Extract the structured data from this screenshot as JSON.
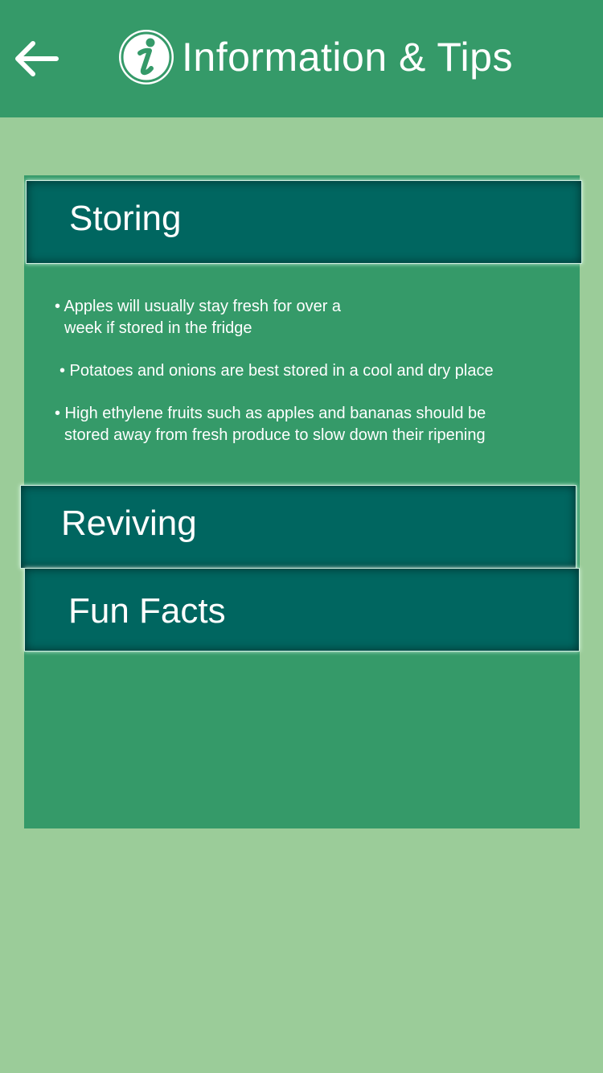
{
  "header": {
    "title": "Information & Tips",
    "back_icon": "arrow-left-icon",
    "info_icon": "info-icon",
    "background_color": "#359a69"
  },
  "sections": [
    {
      "label": "Storing",
      "expanded": true,
      "tips": [
        {
          "lines": [
            "• Apples will usually stay fresh for over a",
            "week if stored in the fridge"
          ]
        },
        {
          "lines": [
            "• Potatoes and onions are best stored in a cool and dry place"
          ]
        },
        {
          "lines": [
            "• High ethylene fruits such as apples and bananas should be",
            "stored away from fresh produce to slow down their ripening"
          ]
        }
      ]
    },
    {
      "label": "Reviving",
      "expanded": false
    },
    {
      "label": "Fun Facts",
      "expanded": false
    }
  ],
  "colors": {
    "page_background": "#9bcc99",
    "panel_background": "#359a69",
    "section_header": "#006660",
    "text": "#ffffff"
  }
}
